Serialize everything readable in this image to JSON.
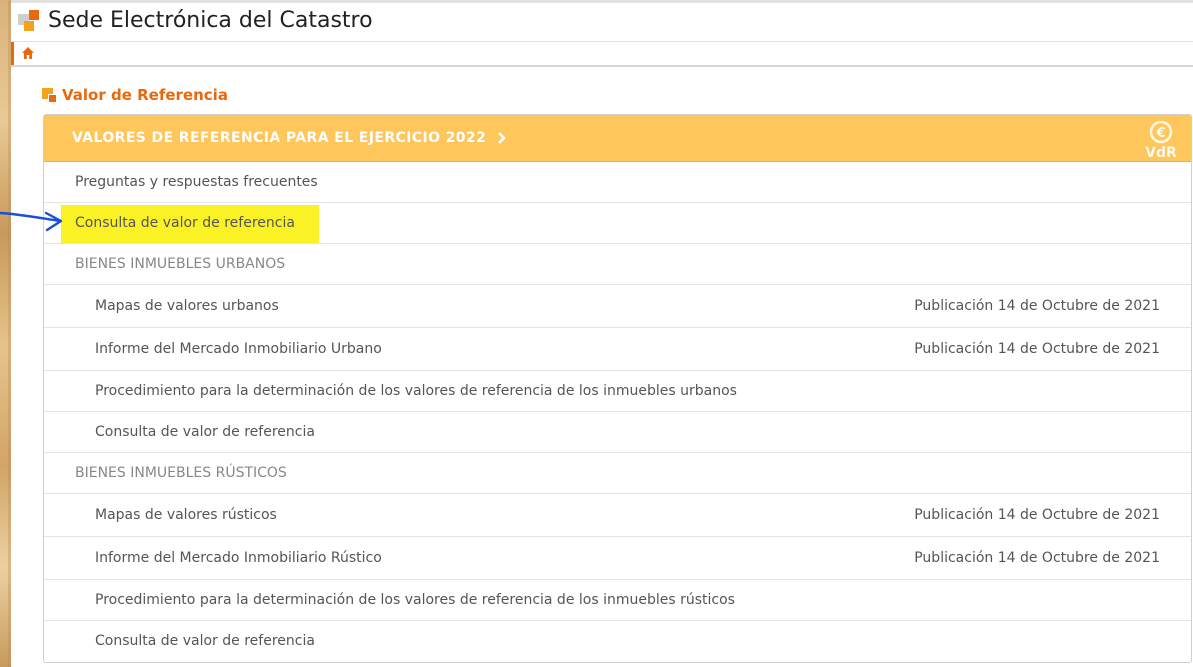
{
  "header": {
    "title": "Sede Electrónica del Catastro"
  },
  "section": {
    "title": "Valor de Referencia"
  },
  "panel": {
    "title": "VALORES DE REFERENCIA PARA EL EJERCICIO 2022",
    "badge_text": "VdR",
    "badge_symbol": "€",
    "rows": [
      {
        "label": "Preguntas y respuestas frecuentes",
        "date": ""
      },
      {
        "label": "Consulta de valor de referencia",
        "date": "",
        "highlighted": true
      },
      {
        "label": "BIENES INMUEBLES URBANOS",
        "date": ""
      },
      {
        "label": "Mapas de valores urbanos",
        "date": "Publicación 14 de Octubre de 2021"
      },
      {
        "label": "Informe del Mercado Inmobiliario Urbano",
        "date": "Publicación 14 de Octubre de 2021"
      },
      {
        "label": "Procedimiento para la determinación de los valores de referencia de los inmuebles urbanos",
        "date": ""
      },
      {
        "label": "Consulta de valor de referencia",
        "date": ""
      },
      {
        "label": "BIENES INMUEBLES RÚSTICOS",
        "date": ""
      },
      {
        "label": "Mapas de valores rústicos",
        "date": "Publicación 14 de Octubre de 2021"
      },
      {
        "label": "Informe del Mercado Inmobiliario Rústico",
        "date": "Publicación 14 de Octubre de 2021"
      },
      {
        "label": "Procedimiento para la determinación de los valores de referencia de los inmuebles rústicos",
        "date": ""
      },
      {
        "label": "Consulta de valor de referencia",
        "date": ""
      }
    ]
  },
  "colors": {
    "accent": "#e8690d",
    "panel_header": "#fec65b",
    "highlight": "#fbf226",
    "annotation": "#1a4fd6"
  },
  "icons": {
    "home": "home-icon",
    "chevron": "chevron-right-icon",
    "badge": "euro-vdr-icon",
    "annotation": "arrow-annotation-icon"
  }
}
